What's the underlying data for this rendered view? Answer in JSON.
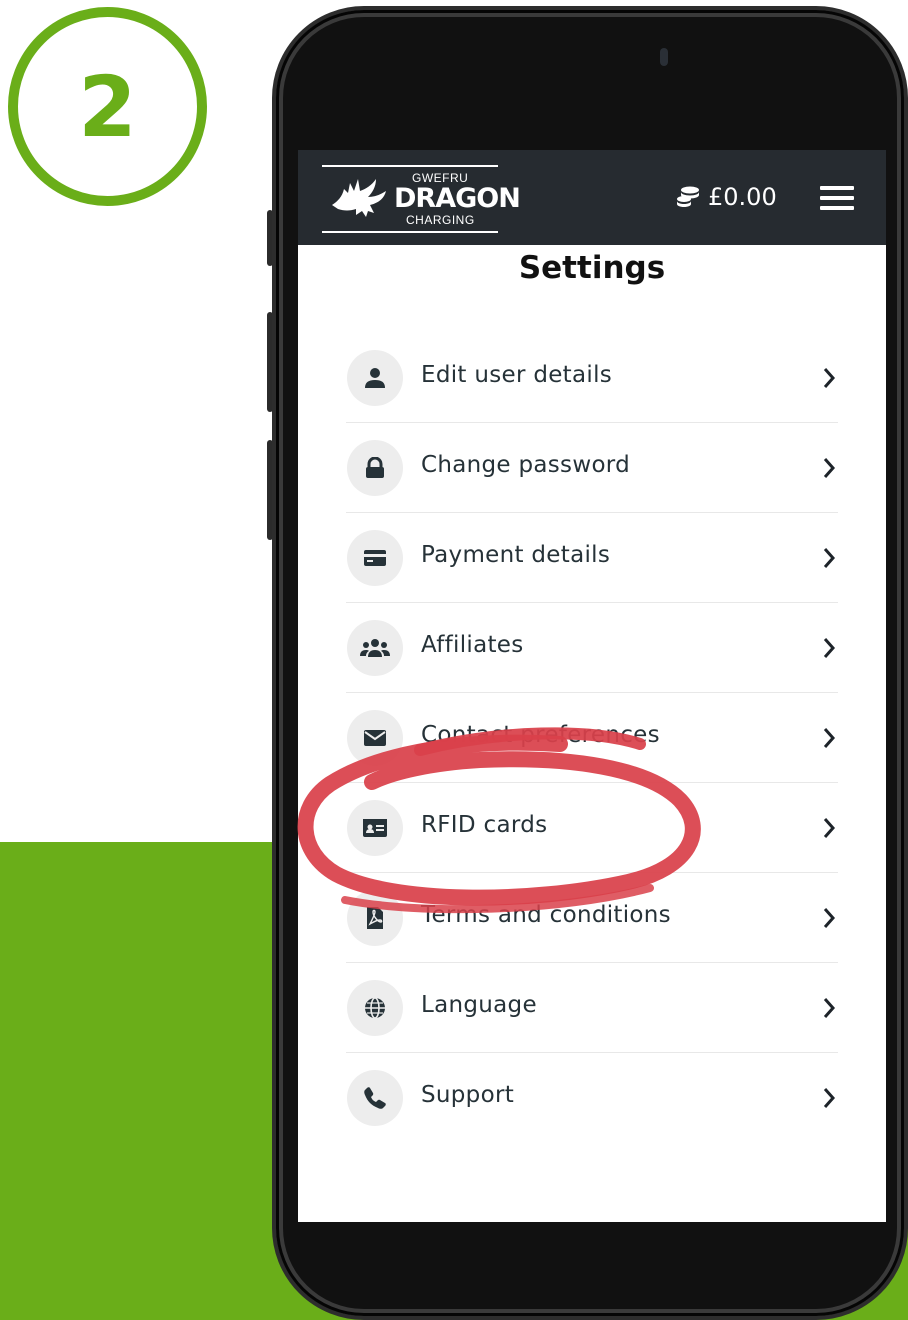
{
  "step": {
    "number": "2"
  },
  "header": {
    "logo": {
      "line1": "GWEFRU",
      "line2": "DRAGON",
      "line3": "CHARGING"
    },
    "wallet_amount": "£0.00"
  },
  "page_title": "Settings",
  "settings_items": [
    {
      "label": "Edit user details",
      "icon": "user-icon"
    },
    {
      "label": "Change password",
      "icon": "lock-icon"
    },
    {
      "label": "Payment details",
      "icon": "credit-card-icon"
    },
    {
      "label": "Affiliates",
      "icon": "users-icon"
    },
    {
      "label": "Contact preferences",
      "icon": "envelope-icon"
    },
    {
      "label": "RFID cards",
      "icon": "id-card-icon"
    },
    {
      "label": "Terms and conditions",
      "icon": "pdf-file-icon"
    },
    {
      "label": "Language",
      "icon": "globe-icon"
    },
    {
      "label": "Support",
      "icon": "phone-icon"
    }
  ],
  "colors": {
    "accent_green": "#6aae19",
    "header_bg": "#262b30",
    "annotation_red": "#d9414a"
  }
}
